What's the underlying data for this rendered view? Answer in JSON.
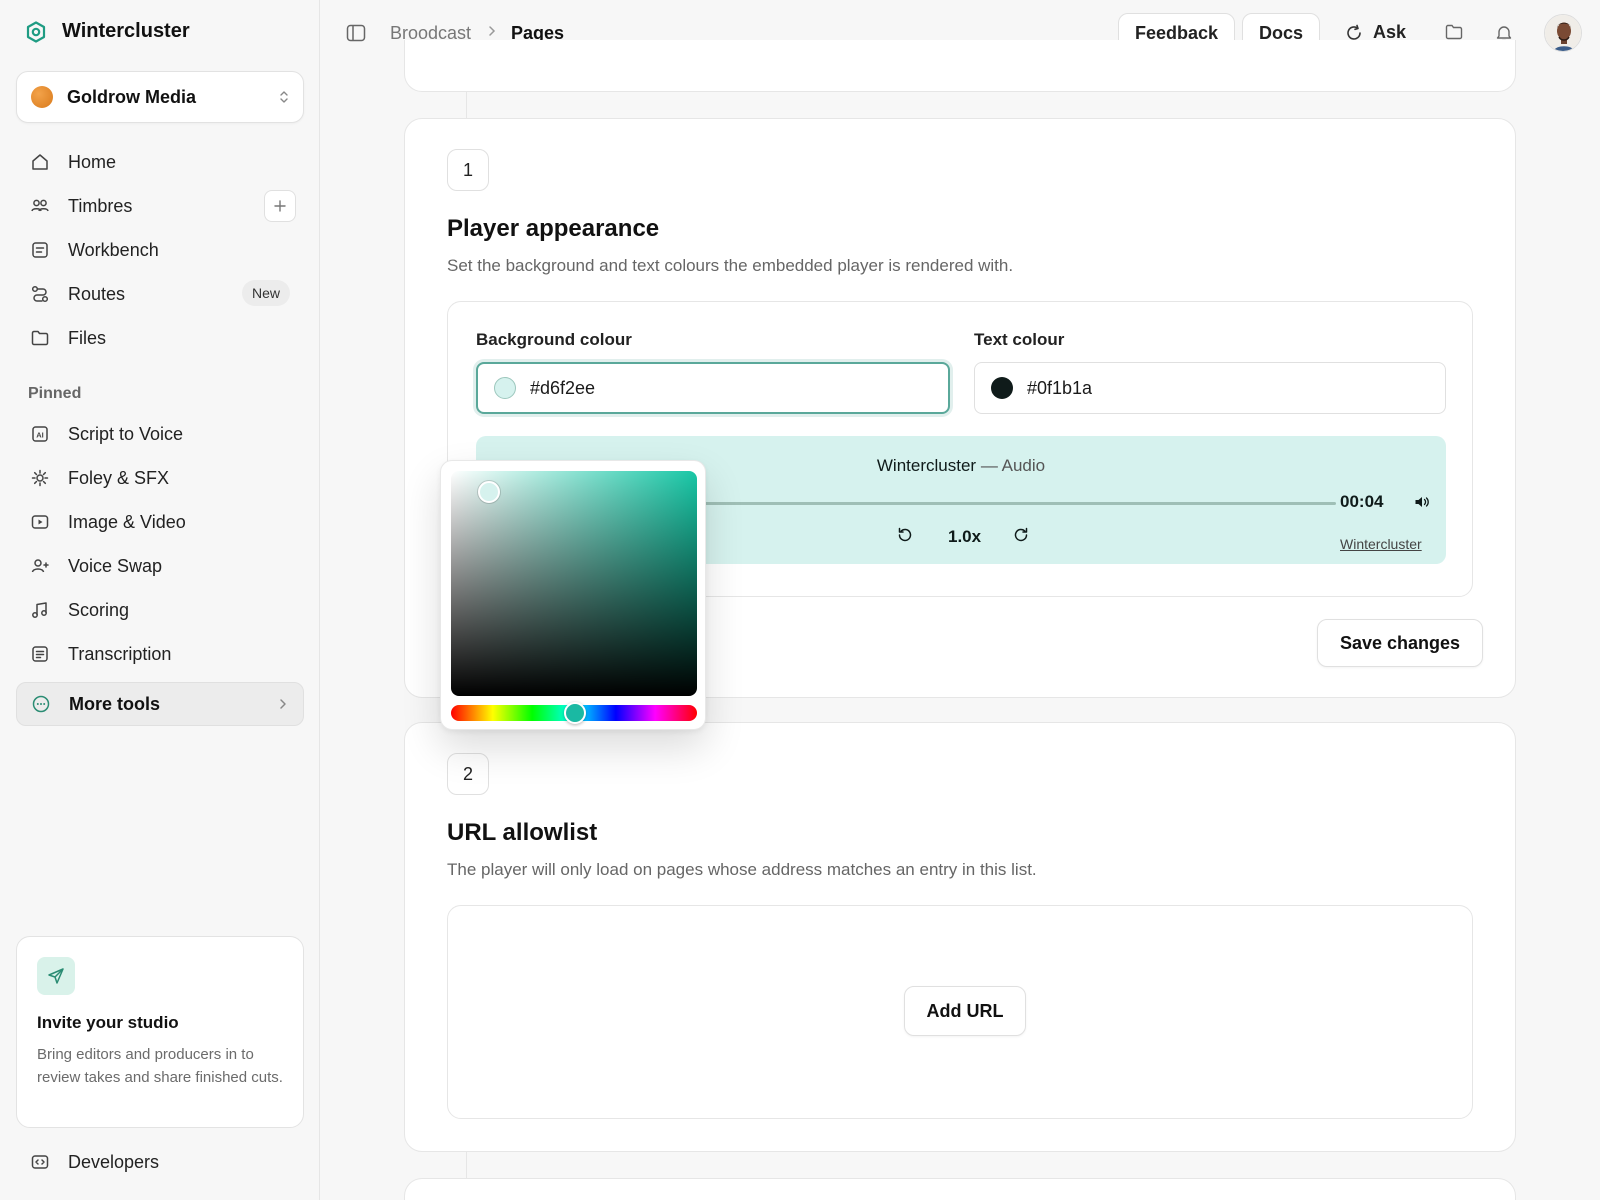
{
  "brand": {
    "name": "Wintercluster"
  },
  "org": {
    "name": "Goldrow Media"
  },
  "nav": {
    "items": [
      {
        "label": "Home"
      },
      {
        "label": "Timbres"
      },
      {
        "label": "Workbench"
      },
      {
        "label": "Routes",
        "badge": "New"
      },
      {
        "label": "Files"
      }
    ],
    "pinned_label": "Pinned",
    "pinned": [
      {
        "label": "Script to Voice"
      },
      {
        "label": "Foley & SFX"
      },
      {
        "label": "Image & Video"
      },
      {
        "label": "Voice Swap"
      },
      {
        "label": "Scoring"
      },
      {
        "label": "Transcription"
      },
      {
        "label": "More tools"
      }
    ],
    "developers": "Developers"
  },
  "invite": {
    "title": "Invite your studio",
    "text": "Bring editors and producers in to review takes and share finished cuts."
  },
  "breadcrumb": {
    "root": "Broodcast",
    "current": "Pages"
  },
  "topbar": {
    "feedback": "Feedback",
    "docs": "Docs",
    "ask": "Ask"
  },
  "section1": {
    "step": "1",
    "title": "Player appearance",
    "desc": "Set the background and text colours the embedded player is rendered with.",
    "bg_label": "Background colour",
    "bg_value": "#d6f2ee",
    "text_label": "Text colour",
    "text_value": "#0f1b1a",
    "player": {
      "title": "Wintercluster",
      "dash": "—",
      "subtitle": "Audio",
      "time": "00:04",
      "speed": "1.0x",
      "link": "Wintercluster"
    },
    "save": "Save changes"
  },
  "section2": {
    "step": "2",
    "title": "URL allowlist",
    "desc": "The player will only load on pages whose address matches an entry in this list.",
    "add": "Add URL"
  },
  "colors": {
    "accent": "#2a8c73",
    "player_bg": "#d6f2ee",
    "player_text": "#0f1b1a",
    "picker_hue": "#18c7a6"
  }
}
